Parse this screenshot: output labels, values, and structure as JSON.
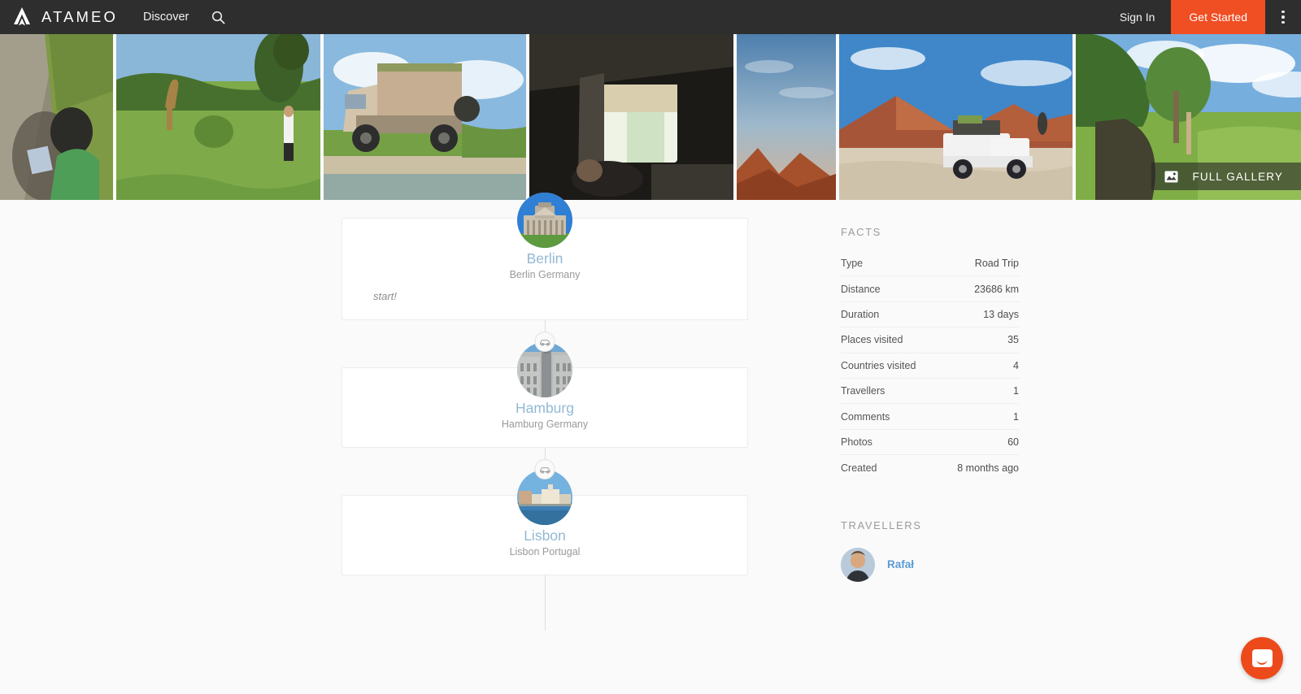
{
  "nav": {
    "brand": "ATAMEO",
    "brand_icon": "ataméo-a-logo-icon",
    "discover": "Discover",
    "search_icon": "search-icon",
    "sign_in": "Sign In",
    "get_started": "Get Started",
    "menu_icon": "kebab-menu-icon",
    "accent_color": "#f04e23",
    "bar_color": "#2e2e2e"
  },
  "gallery": {
    "full_gallery_label": "FULL GALLERY",
    "full_gallery_icon": "photo-icon",
    "photos": [
      {
        "alt": "person sitting on dirt road shoulder"
      },
      {
        "alt": "giraffe in green savanna with traveller"
      },
      {
        "alt": "overland expedition truck by water crossing"
      },
      {
        "alt": "view out of a roof tent"
      },
      {
        "alt": "desert sunset sky"
      },
      {
        "alt": "pickup truck with roof tent at red sand dunes"
      },
      {
        "alt": "tree and water in green wetland"
      }
    ]
  },
  "timeline": {
    "stops": [
      {
        "name": "Berlin",
        "location": "Berlin Germany",
        "note": "start!",
        "image_alt": "Reichstag building in Berlin"
      },
      {
        "name": "Hamburg",
        "location": "Hamburg Germany",
        "note": "",
        "image_alt": "Hamburg city hall facade"
      },
      {
        "name": "Lisbon",
        "location": "Lisbon Portugal",
        "note": "",
        "image_alt": "Lisbon waterfront from the river"
      }
    ],
    "connector_icon": "car-icon",
    "link_color": "#92b9d4"
  },
  "facts": {
    "title": "FACTS",
    "rows": [
      {
        "label": "Type",
        "value": "Road Trip"
      },
      {
        "label": "Distance",
        "value": "23686 km"
      },
      {
        "label": "Duration",
        "value": "13 days"
      },
      {
        "label": "Places visited",
        "value": "35"
      },
      {
        "label": "Countries visited",
        "value": "4"
      },
      {
        "label": "Travellers",
        "value": "1"
      },
      {
        "label": "Comments",
        "value": "1"
      },
      {
        "label": "Photos",
        "value": "60"
      },
      {
        "label": "Created",
        "value": "8 months ago"
      }
    ]
  },
  "travellers": {
    "title": "TRAVELLERS",
    "people": [
      {
        "name": "Rafał",
        "avatar_alt": "portrait of Rafał"
      }
    ]
  },
  "chat": {
    "icon": "chat-bubble-icon",
    "color": "#ec4a1a"
  }
}
